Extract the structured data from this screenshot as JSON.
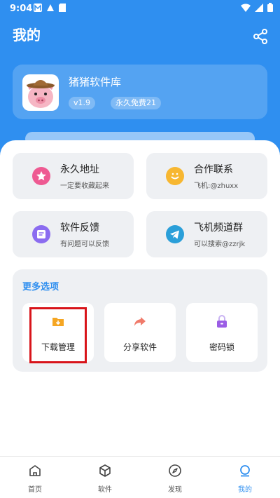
{
  "status": {
    "time": "9:04"
  },
  "header": {
    "title": "我的"
  },
  "profile": {
    "name": "猪猪软件库",
    "version": "v1.9",
    "plan": "永久免费21"
  },
  "cards": [
    {
      "title": "永久地址",
      "subtitle": "一定要收藏起来",
      "icon": "star-badge-icon",
      "color": "#ee5a92"
    },
    {
      "title": "合作联系",
      "subtitle": "飞机:@zhuxx",
      "icon": "smile-chat-icon",
      "color": "#f7b731"
    },
    {
      "title": "软件反馈",
      "subtitle": "有问题可以反馈",
      "icon": "feedback-icon",
      "color": "#8b6cf0"
    },
    {
      "title": "飞机频道群",
      "subtitle": "可以搜索@zzrjk",
      "icon": "telegram-icon",
      "color": "#2a9fd9"
    }
  ],
  "more": {
    "title": "更多选项",
    "options": [
      {
        "label": "下载管理",
        "icon": "download-folder-icon",
        "color": "#f5a623"
      },
      {
        "label": "分享软件",
        "icon": "share-arrow-icon",
        "color": "#f07a6a"
      },
      {
        "label": "密码锁",
        "icon": "lock-icon",
        "color": "#9b5de5"
      }
    ]
  },
  "tabs": [
    {
      "label": "首页",
      "icon": "home-icon"
    },
    {
      "label": "软件",
      "icon": "cube-icon"
    },
    {
      "label": "发现",
      "icon": "compass-icon"
    },
    {
      "label": "我的",
      "icon": "profile-icon",
      "active": true
    }
  ],
  "colors": {
    "primary": "#2f8ff0",
    "highlight": "#d8141a"
  }
}
